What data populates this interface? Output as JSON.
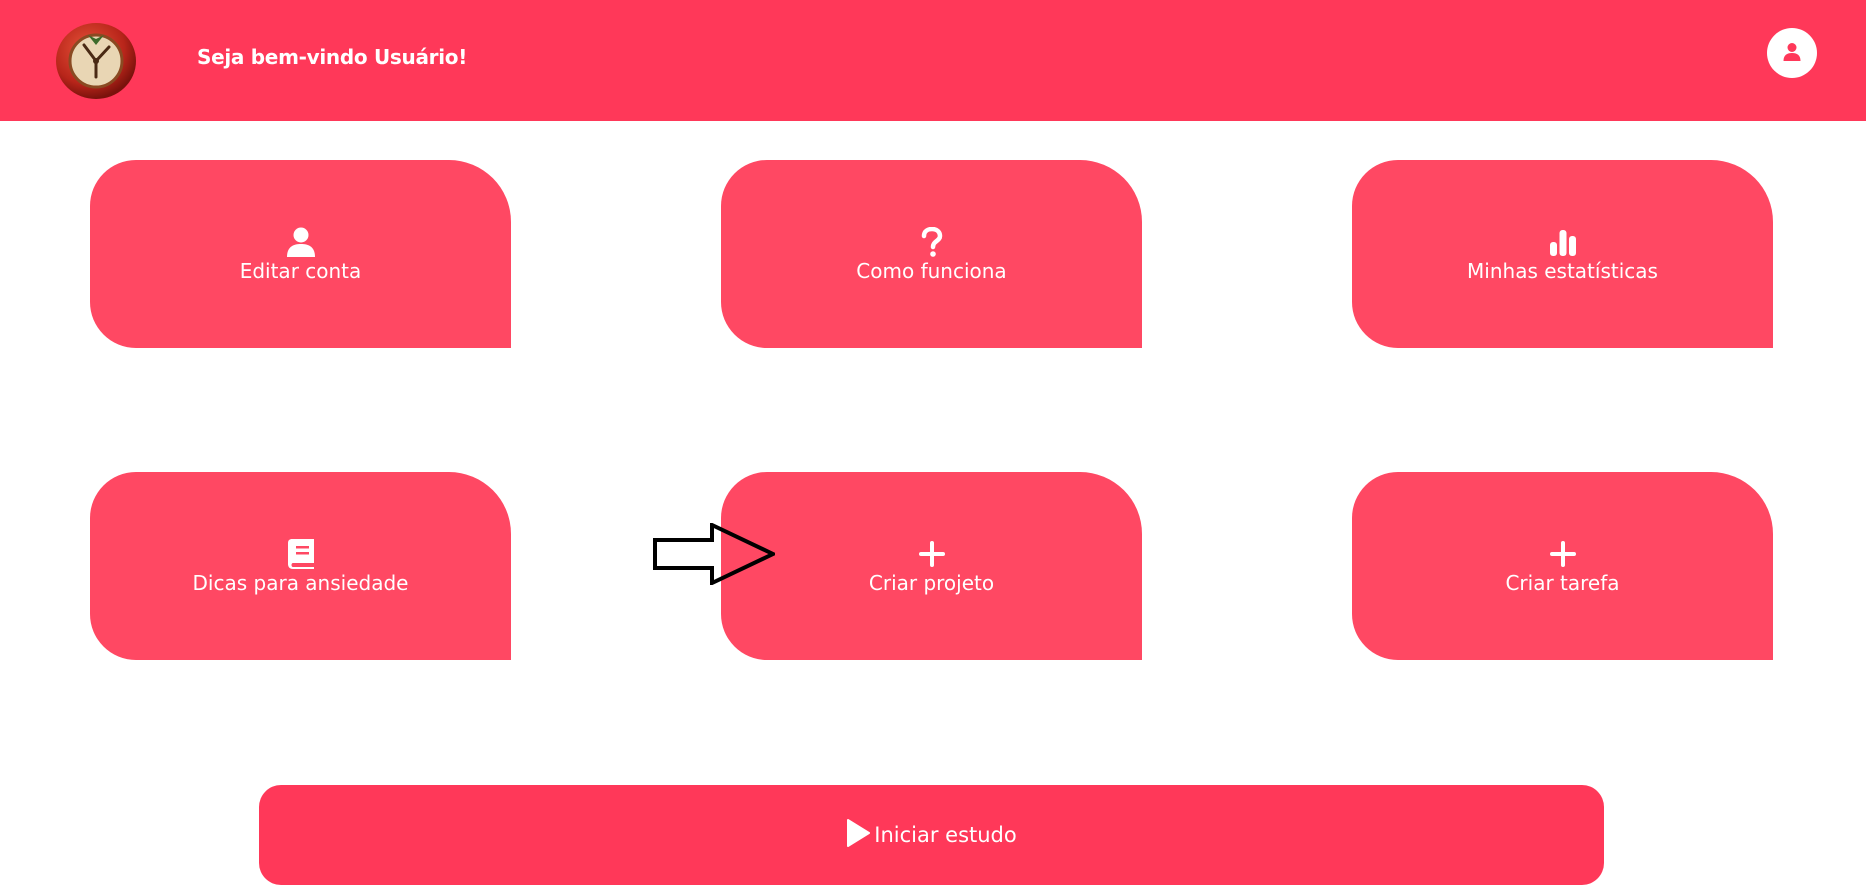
{
  "header": {
    "welcome_text": "Seja bem-vindo Usuário!",
    "logo_icon": "pomodoro-clock-logo-icon",
    "profile_icon": "user-icon"
  },
  "cards": [
    {
      "label": "Editar conta",
      "icon": "user-icon"
    },
    {
      "label": "Como funciona",
      "icon": "question-mark-icon"
    },
    {
      "label": "Minhas estatísticas",
      "icon": "bar-chart-icon"
    },
    {
      "label": "Dicas para ansiedade",
      "icon": "book-icon"
    },
    {
      "label": "Criar projeto",
      "icon": "plus-icon"
    },
    {
      "label": "Criar tarefa",
      "icon": "plus-icon"
    }
  ],
  "start": {
    "label": "Iniciar estudo",
    "icon": "play-icon"
  },
  "annotation": {
    "icon": "right-arrow-icon"
  },
  "colors": {
    "header": "#ff3859",
    "card": "#ff4863",
    "button": "#ff3859",
    "text": "#ffffff"
  }
}
